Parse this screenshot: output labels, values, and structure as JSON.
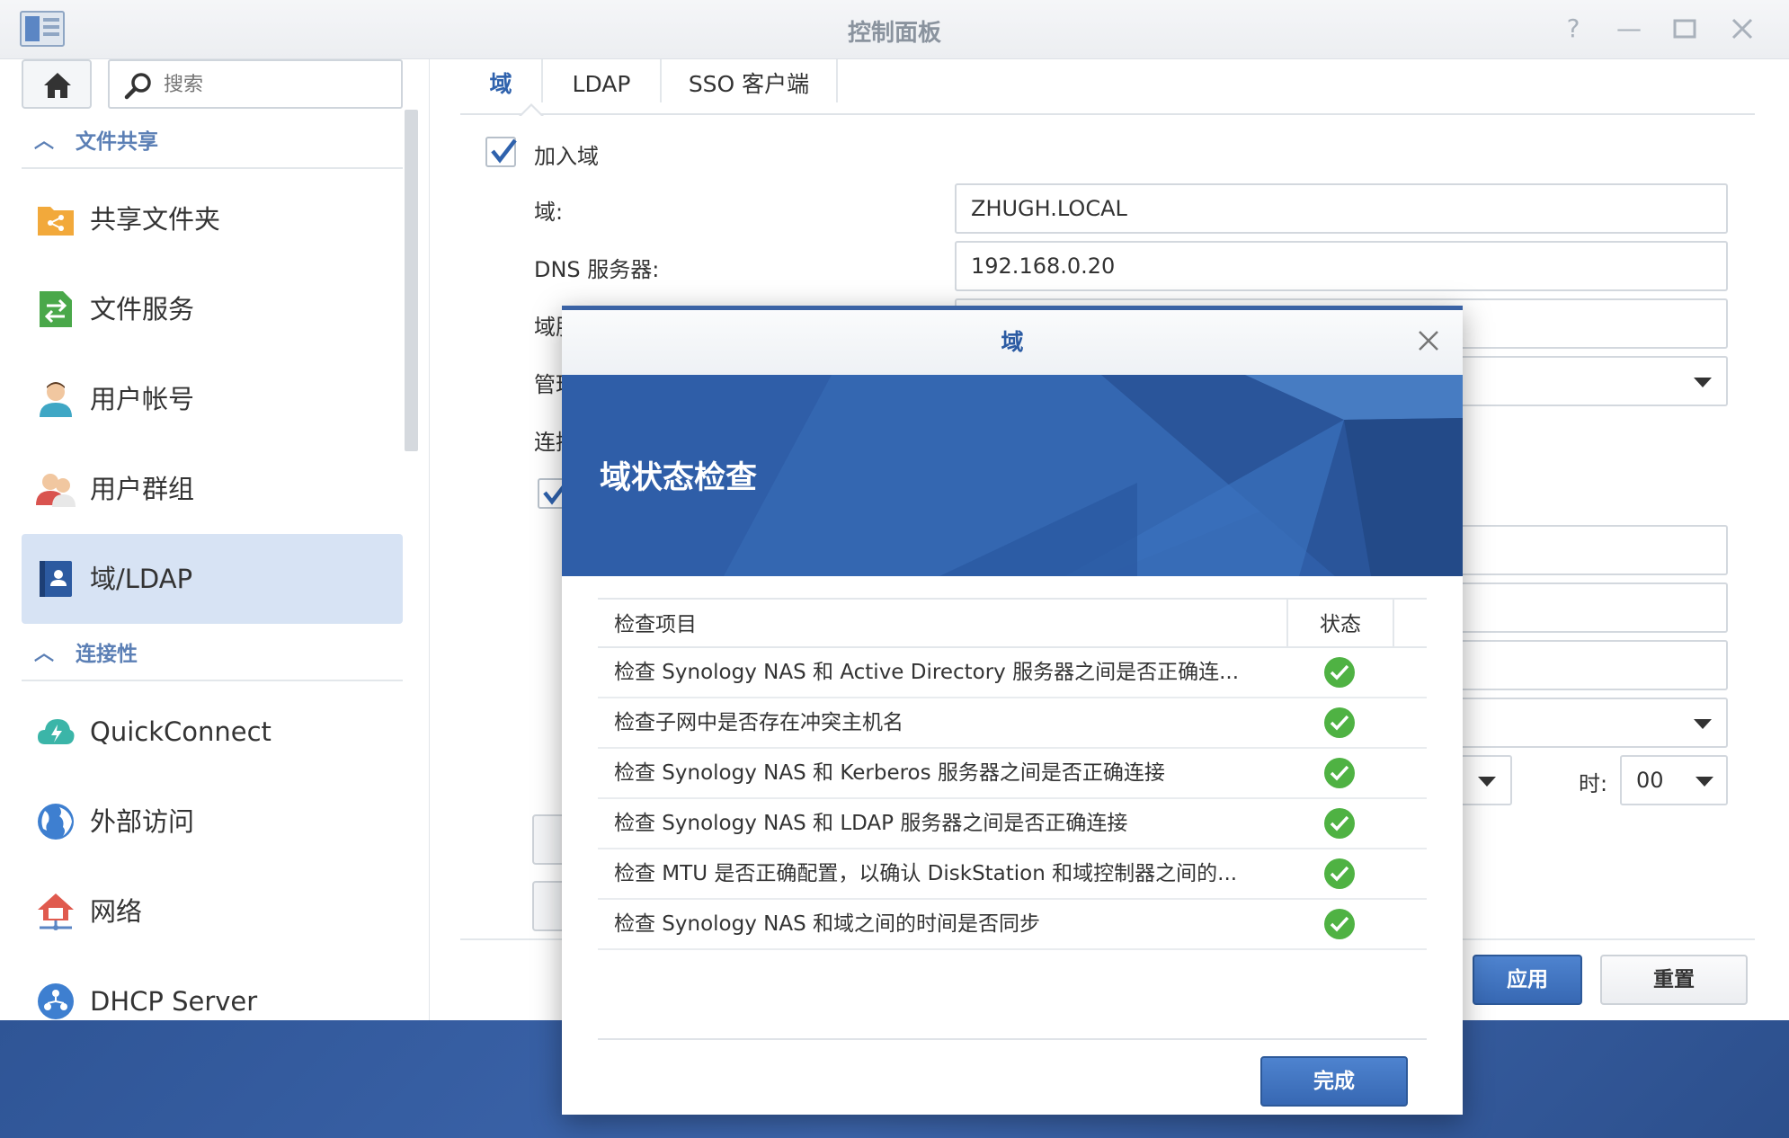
{
  "window": {
    "title": "控制面板"
  },
  "sidebar": {
    "search_placeholder": "搜索",
    "sections": [
      {
        "label": "文件共享"
      },
      {
        "label": "连接性"
      }
    ],
    "items": [
      {
        "label": "共享文件夹",
        "icon": "shared-folder-icon"
      },
      {
        "label": "文件服务",
        "icon": "file-services-icon"
      },
      {
        "label": "用户帐号",
        "icon": "user-icon"
      },
      {
        "label": "用户群组",
        "icon": "group-icon"
      },
      {
        "label": "域/LDAP",
        "icon": "directory-icon",
        "active": true
      },
      {
        "label": "QuickConnect",
        "icon": "quickconnect-icon"
      },
      {
        "label": "外部访问",
        "icon": "globe-icon"
      },
      {
        "label": "网络",
        "icon": "network-icon"
      },
      {
        "label": "DHCP Server",
        "icon": "dhcp-icon"
      }
    ]
  },
  "tabs": [
    {
      "label": "域",
      "active": true
    },
    {
      "label": "LDAP"
    },
    {
      "label": "SSO 客户端"
    }
  ],
  "form": {
    "join_domain_label": "加入域",
    "join_domain_checked": true,
    "domain_label": "域:",
    "domain_value": "ZHUGH.LOCAL",
    "dns_label": "DNS 服务器:",
    "dns_value": "192.168.0.20",
    "partial_label_3": "域服",
    "partial_label_4": "管理",
    "partial_label_5": "连接",
    "hour_label": "时:",
    "hour_value": "00",
    "apply_label": "应用",
    "reset_label": "重置"
  },
  "dialog": {
    "title": "域",
    "banner_title": "域状态检查",
    "col_item": "检查项目",
    "col_status": "状态",
    "rows": [
      {
        "text": "检查 Synology NAS 和 Active Directory 服务器之间是否正确连...",
        "status": "ok"
      },
      {
        "text": "检查子网中是否存在冲突主机名",
        "status": "ok"
      },
      {
        "text": "检查 Synology NAS 和 Kerberos 服务器之间是否正确连接",
        "status": "ok"
      },
      {
        "text": "检查 Synology NAS 和 LDAP 服务器之间是否正确连接",
        "status": "ok"
      },
      {
        "text": "检查 MTU 是否正确配置，以确认 DiskStation 和域控制器之间的...",
        "status": "ok"
      },
      {
        "text": "检查 Synology NAS 和域之间的时间是否同步",
        "status": "ok"
      }
    ],
    "done_label": "完成"
  },
  "colors": {
    "accent": "#3768b3",
    "status_ok": "#4fb243",
    "banner": "#2f5ea8"
  }
}
